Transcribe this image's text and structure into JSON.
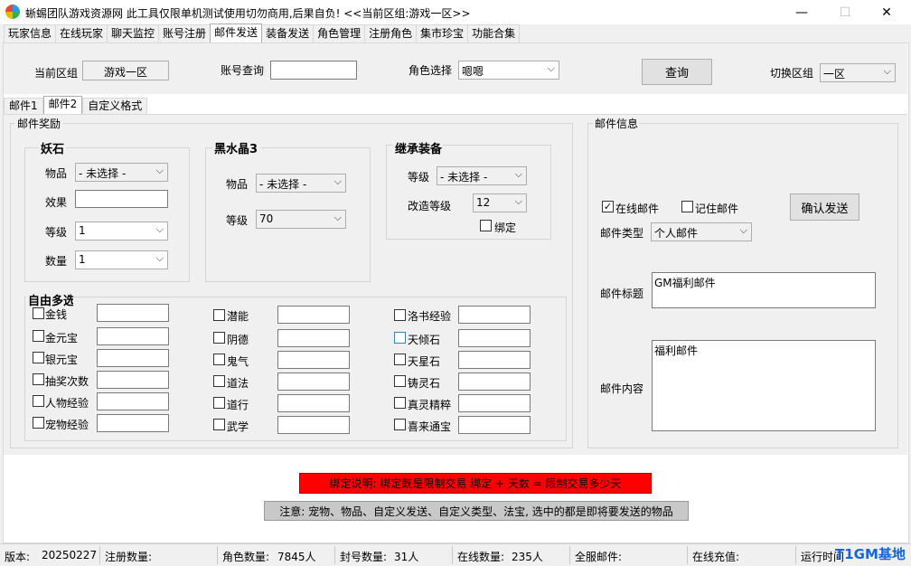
{
  "window": {
    "title": "蜥蜴团队游戏资源网 此工具仅限单机测试使用切勿商用,后果自负! <<当前区组:游戏一区>>",
    "minimize": "—",
    "maximize": "☐",
    "close": "✕"
  },
  "tabs": [
    "玩家信息",
    "在线玩家",
    "聊天监控",
    "账号注册",
    "邮件发送",
    "装备发送",
    "角色管理",
    "注册角色",
    "集市珍宝",
    "功能合集"
  ],
  "top": {
    "zone_label": "当前区组",
    "zone_value": "游戏一区",
    "account_label": "账号查询",
    "account_value": "",
    "role_label": "角色选择",
    "role_value": "嗯嗯",
    "query_button": "查询",
    "switch_label": "切换区组",
    "switch_value": "一区"
  },
  "subtabs": [
    "邮件1",
    "邮件2",
    "自定义格式"
  ],
  "reward": {
    "title": "邮件奖励",
    "yaoshi": {
      "title": "妖石",
      "item_label": "物品",
      "item_value": "- 未选择 -",
      "effect_label": "效果",
      "effect_value": "",
      "level_label": "等级",
      "level_value": "1",
      "count_label": "数量",
      "count_value": "1"
    },
    "heishui": {
      "title": "黑水晶3",
      "item_label": "物品",
      "item_value": "- 未选择 -",
      "level_label": "等级",
      "level_value": "70"
    },
    "jicheng": {
      "title": "继承装备",
      "level_label": "等级",
      "level_value": "- 未选择 -",
      "refine_label": "改造等级",
      "refine_value": "12",
      "bind_label": "绑定"
    },
    "free": {
      "title": "自由多选",
      "col1": [
        "金钱",
        "金元宝",
        "银元宝",
        "抽奖次数",
        "人物经验",
        "宠物经验"
      ],
      "col2": [
        "潜能",
        "阴德",
        "鬼气",
        "道法",
        "道行",
        "武学"
      ],
      "col3": [
        "洛书经验",
        "天倾石",
        "天星石",
        "铸灵石",
        "真灵精粹",
        "喜来通宝"
      ]
    }
  },
  "mail_info": {
    "title": "邮件信息",
    "online_mail": "在线邮件",
    "online_checked": true,
    "remember_mail": "记住邮件",
    "remember_checked": false,
    "confirm_button": "确认发送",
    "type_label": "邮件类型",
    "type_value": "个人邮件",
    "subject_label": "邮件标题",
    "subject_value": "GM福利邮件",
    "content_label": "邮件内容",
    "content_value": "福利邮件"
  },
  "notes": {
    "bind": "绑定说明: 绑定既是限制交易 绑定 + 天数 = 限制交易多少天",
    "hint": "注意: 宠物、物品、自定义发送、自定义类型、法宝, 选中的都是即将要发送的物品"
  },
  "status": {
    "version_label": "版本:",
    "version_value": "20250227",
    "reg_label": "注册数量:",
    "reg_value": "",
    "role_label": "角色数量:",
    "role_value": "7845人",
    "ban_label": "封号数量:",
    "ban_value": "31人",
    "online_label": "在线数量:",
    "online_value": "235人",
    "all_mail_label": "全服邮件:",
    "recharge_label": "在线充值:",
    "runtime_label": "运行时间",
    "watermark": "T1GM基地"
  },
  "colors": {
    "bind_bar": "#ff0000",
    "hint_bar": "#c8c8c8",
    "watermark": "#1565d8"
  }
}
